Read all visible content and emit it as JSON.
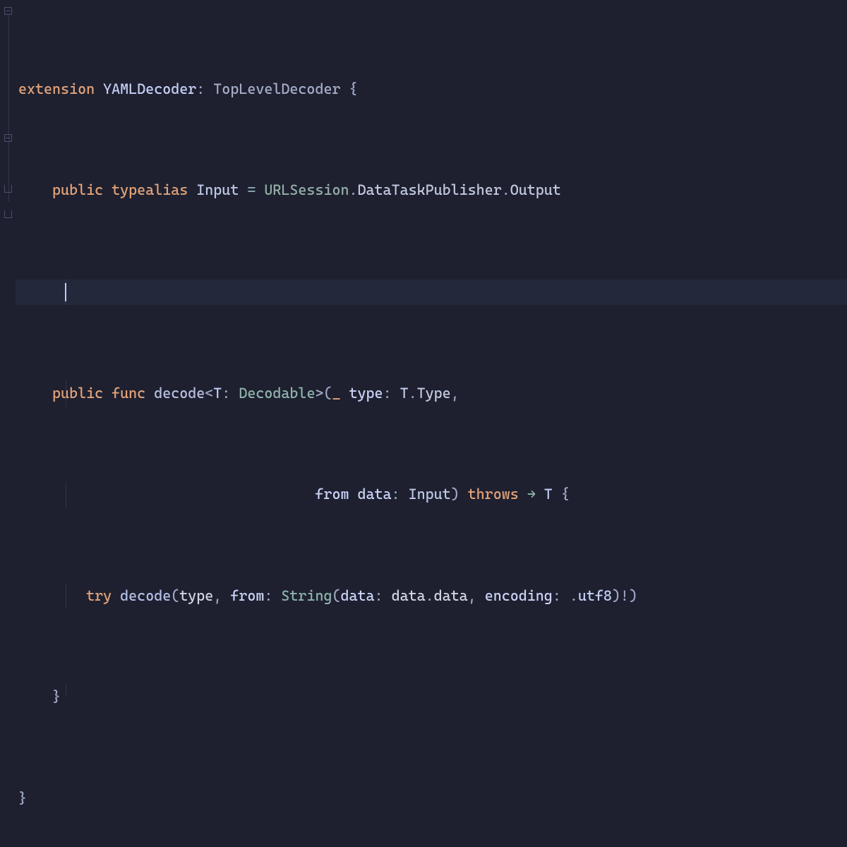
{
  "code": {
    "line1": {
      "kw_extension": "extension",
      "type_yaml": "YAMLDecoder",
      "colon": ":",
      "type_top": "TopLevelDecoder",
      "brace": "{"
    },
    "line2": {
      "kw_public": "public",
      "kw_typealias": "typealias",
      "type_input": "Input",
      "eq": "=",
      "type_url": "URLSession",
      "dot1": ".",
      "type_dtp": "DataTaskPublisher",
      "dot2": ".",
      "type_output": "Output"
    },
    "line4": {
      "kw_public": "public",
      "kw_func": "func",
      "fn_decode": "decode",
      "lt": "<",
      "generic_t": "T",
      "colon": ":",
      "proto": "Decodable",
      "gt": ">",
      "lparen": "(",
      "underscore": "_",
      "param_type": "type",
      "colon2": ":",
      "t2": "T",
      "dot": ".",
      "type_word": "Type",
      "comma": ","
    },
    "line5": {
      "from": "from",
      "data": "data",
      "colon": ":",
      "input": "Input",
      "rparen": ")",
      "throws": "throws",
      "arrow": "→",
      "t": "T",
      "brace": "{"
    },
    "line6": {
      "try": "try",
      "decode": "decode",
      "lparen": "(",
      "type": "type",
      "comma1": ",",
      "from": "from",
      "colon1": ":",
      "string": "String",
      "lparen2": "(",
      "data_label": "data",
      "colon2": ":",
      "data_expr": "data",
      "dot": ".",
      "data_prop": "data",
      "comma2": ",",
      "encoding": "encoding",
      "colon3": ":",
      "dot2": ".",
      "utf8": "utf8",
      "rparen2": ")",
      "bang": "!",
      "rparen": ")"
    },
    "line7": {
      "brace": "}"
    },
    "line8": {
      "brace": "}"
    }
  },
  "gutter": {
    "fold_collapse": "⊟",
    "fold_expand": "⊟",
    "struct_marker": "⎕"
  }
}
